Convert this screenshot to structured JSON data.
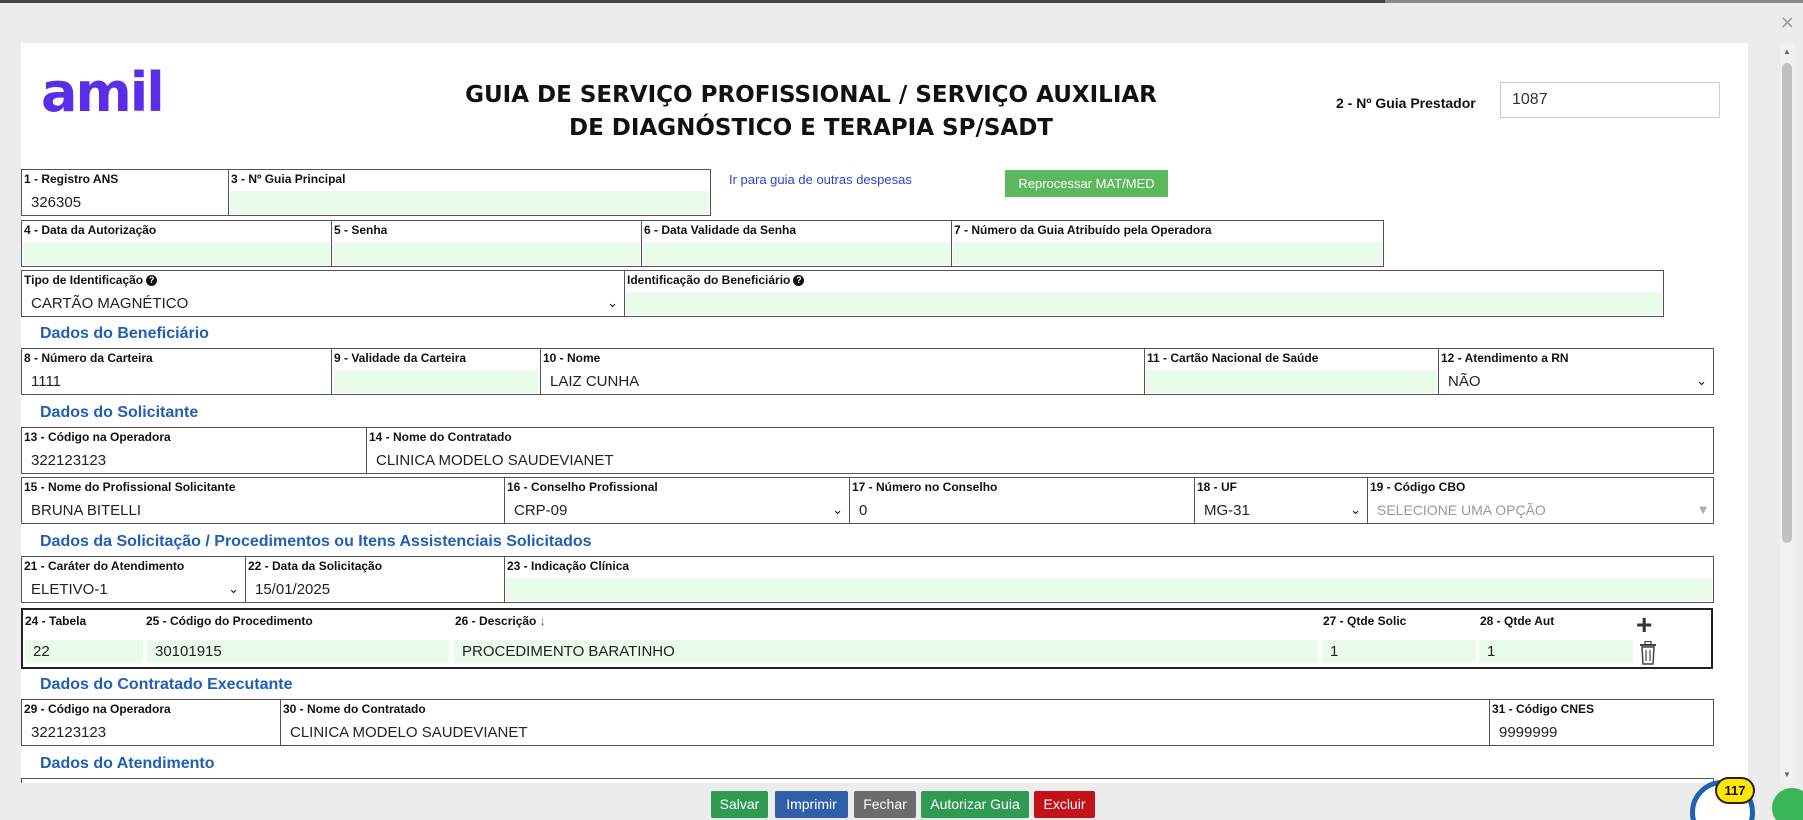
{
  "window": {
    "close_icon": "×"
  },
  "header": {
    "logo": "amil",
    "title_line1": "GUIA DE SERVIÇO PROFISSIONAL / SERVIÇO AUXILIAR",
    "title_line2": "DE DIAGNÓSTICO E TERAPIA SP/SADT",
    "guia_prestador_label": "2 - Nº Guia Prestador",
    "guia_prestador_value": "1087"
  },
  "row1": {
    "registro_ans_label": "1 - Registro ANS",
    "registro_ans_value": "326305",
    "guia_principal_label": "3 - Nº Guia Principal",
    "guia_principal_value": "",
    "link_outras_despesas": "Ir para guia de outras despesas",
    "btn_reprocessar": "Reprocessar MAT/MED"
  },
  "row2": {
    "data_autorizacao_label": "4 - Data da Autorização",
    "senha_label": "5 - Senha",
    "data_validade_senha_label": "6 - Data Validade da Senha",
    "numero_guia_operadora_label": "7 - Número da Guia Atribuído pela Operadora"
  },
  "row3": {
    "tipo_identificacao_label": "Tipo de Identificação",
    "tipo_identificacao_value": "CARTÃO MAGNÉTICO",
    "identificacao_beneficiario_label": "Identificação do Beneficiário"
  },
  "beneficiario": {
    "section_title": "Dados do Beneficiário",
    "numero_carteira_label": "8 - Número da Carteira",
    "numero_carteira_value": "1111",
    "validade_carteira_label": "9 - Validade da Carteira",
    "nome_label": "10 - Nome",
    "nome_value": "LAIZ CUNHA",
    "cartao_nacional_label": "11 - Cartão Nacional de Saúde",
    "atendimento_rn_label": "12 - Atendimento a RN",
    "atendimento_rn_value": "NÃO"
  },
  "solicitante": {
    "section_title": "Dados do Solicitante",
    "codigo_operadora_label": "13 - Código na Operadora",
    "codigo_operadora_value": "322123123",
    "nome_contratado_label": "14 - Nome do Contratado",
    "nome_contratado_value": "CLINICA MODELO SAUDEVIANET",
    "nome_profissional_label": "15 - Nome do Profissional Solicitante",
    "nome_profissional_value": "BRUNA BITELLI",
    "conselho_label": "16 - Conselho Profissional",
    "conselho_value": "CRP-09",
    "numero_conselho_label": "17 - Número no Conselho",
    "numero_conselho_value": "0",
    "uf_label": "18 - UF",
    "uf_value": "MG-31",
    "cbo_label": "19 - Código CBO",
    "cbo_placeholder": "SELECIONE UMA OPÇÃO"
  },
  "solicitacao": {
    "section_title": "Dados da Solicitação / Procedimentos ou Itens Assistenciais Solicitados",
    "carater_label": "21 - Caráter do Atendimento",
    "carater_value": "ELETIVO-1",
    "data_solicitacao_label": "22 - Data da Solicitação",
    "data_solicitacao_value": "15/01/2025",
    "indicacao_label": "23 - Indicação Clínica",
    "tabela_label": "24 - Tabela",
    "codigo_proc_label": "25 - Código do Procedimento",
    "descricao_label": "26 - Descrição",
    "qtde_solic_label": "27 - Qtde Solic",
    "qtde_aut_label": "28 - Qtde Aut",
    "tabela_value": "22",
    "codigo_proc_value": "30101915",
    "descricao_value": "PROCEDIMENTO BARATINHO",
    "qtde_solic_value": "1",
    "qtde_aut_value": "1",
    "sort_icon": "↓",
    "add_icon": "+"
  },
  "executante": {
    "section_title": "Dados do Contratado Executante",
    "codigo_operadora_label": "29 - Código na Operadora",
    "codigo_operadora_value": "322123123",
    "nome_contratado_label": "30 - Nome do Contratado",
    "nome_contratado_value": "CLINICA MODELO SAUDEVIANET",
    "cnes_label": "31 - Código CNES",
    "cnes_value": "9999999"
  },
  "atendimento": {
    "section_title": "Dados do Atendimento"
  },
  "footer": {
    "salvar": "Salvar",
    "imprimir": "Imprimir",
    "fechar": "Fechar",
    "autorizar": "Autorizar Guia",
    "excluir": "Excluir",
    "badge_count": "117"
  },
  "colors": {
    "brand": "#5a2ee8",
    "section": "#1f5fb4",
    "field_bg": "#e9fbe9",
    "salvar": "#2e9a52",
    "imprimir": "#2f5fa8",
    "fechar": "#6b6b6b",
    "autorizar": "#2e9a52",
    "excluir": "#c4121a"
  }
}
